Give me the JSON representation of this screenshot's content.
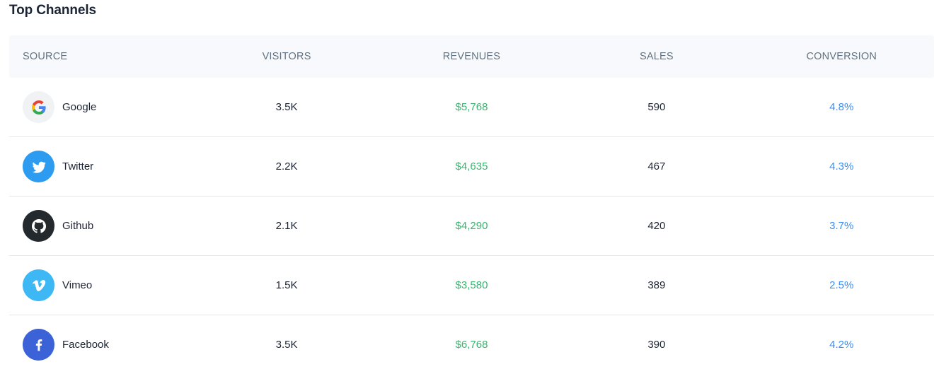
{
  "title": "Top Channels",
  "headers": {
    "source": "SOURCE",
    "visitors": "VISITORS",
    "revenues": "REVENUES",
    "sales": "SALES",
    "conversion": "CONVERSION"
  },
  "rows": [
    {
      "source": "Google",
      "icon": "google-icon",
      "visitors": "3.5K",
      "revenues": "$5,768",
      "sales": "590",
      "conversion": "4.8%"
    },
    {
      "source": "Twitter",
      "icon": "twitter-icon",
      "visitors": "2.2K",
      "revenues": "$4,635",
      "sales": "467",
      "conversion": "4.3%"
    },
    {
      "source": "Github",
      "icon": "github-icon",
      "visitors": "2.1K",
      "revenues": "$4,290",
      "sales": "420",
      "conversion": "3.7%"
    },
    {
      "source": "Vimeo",
      "icon": "vimeo-icon",
      "visitors": "1.5K",
      "revenues": "$3,580",
      "sales": "389",
      "conversion": "2.5%"
    },
    {
      "source": "Facebook",
      "icon": "facebook-icon",
      "visitors": "3.5K",
      "revenues": "$6,768",
      "sales": "390",
      "conversion": "4.2%"
    }
  ],
  "colors": {
    "revenue": "#3cb371",
    "conversion": "#3c8ef2",
    "header_bg": "#f7f9fc",
    "google_bg": "#f1f2f4",
    "twitter_bg": "#2d9bf0",
    "github_bg": "#24292e",
    "vimeo_bg": "#3db8f5",
    "facebook_bg": "#3b62d6"
  }
}
